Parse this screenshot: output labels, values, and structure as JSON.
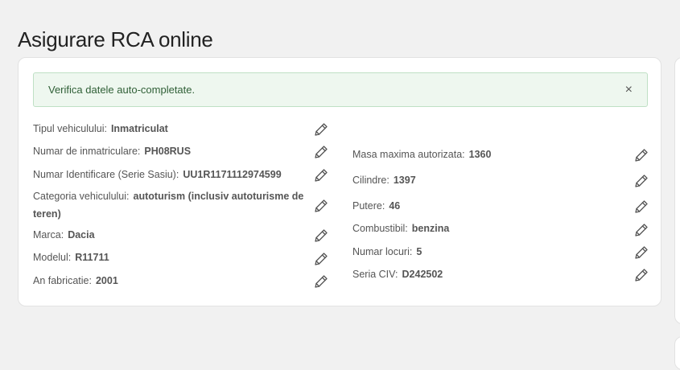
{
  "page": {
    "title": "Asigurare RCA online"
  },
  "alert": {
    "message": "Verifica datele auto-completate.",
    "close_symbol": "×"
  },
  "left_fields": [
    {
      "label": "Tipul vehiculului:",
      "value": "Inmatriculat"
    },
    {
      "label": "Numar de inmatriculare:",
      "value": "PH08RUS"
    },
    {
      "label": "Numar Identificare (Serie Sasiu):",
      "value": "UU1R1171112974599"
    },
    {
      "label": "Categoria vehiculului:",
      "value": "autoturism (inclusiv autoturisme de",
      "value_line2": "teren)"
    },
    {
      "label": "Marca:",
      "value": "Dacia"
    },
    {
      "label": "Modelul:",
      "value": "R11711"
    },
    {
      "label": "An fabricatie:",
      "value": "2001"
    }
  ],
  "right_fields": [
    {
      "label": "Masa maxima autorizata:",
      "value": "1360"
    },
    {
      "label": "Cilindre:",
      "value": "1397"
    },
    {
      "label": "Putere:",
      "value": "46"
    },
    {
      "label": "Combustibil:",
      "value": "benzina"
    },
    {
      "label": "Numar locuri:",
      "value": "5"
    },
    {
      "label": "Seria CIV:",
      "value": "D242502"
    }
  ],
  "icons": {
    "edit": "pencil-icon",
    "close": "close-icon"
  },
  "colors": {
    "alert_bg": "#eef7ef",
    "alert_border": "#bfe0c5",
    "alert_text": "#2f5f36"
  }
}
